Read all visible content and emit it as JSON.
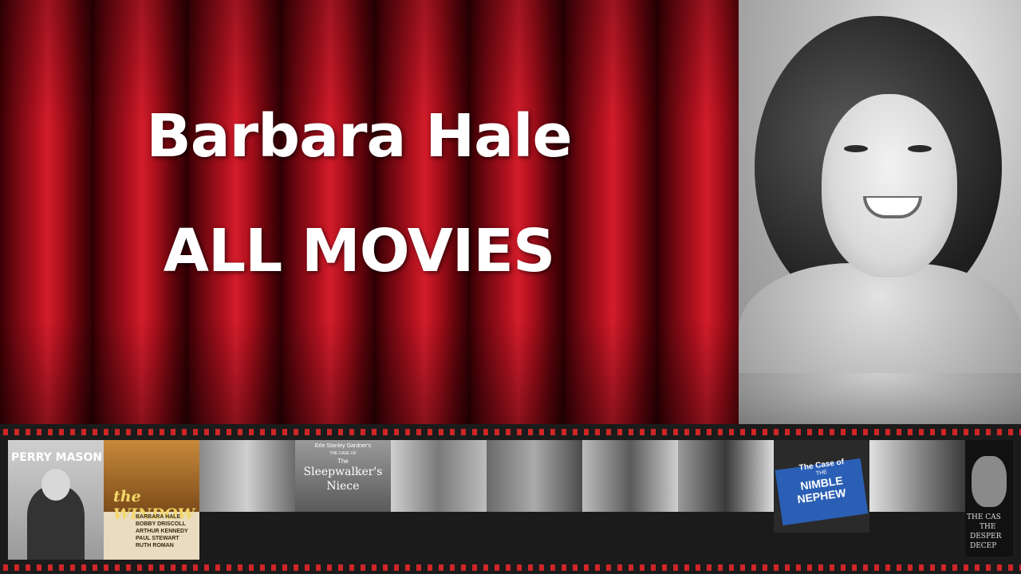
{
  "header": {
    "title_line1": "Barbara Hale",
    "title_line2": "ALL MOVIES"
  },
  "colors": {
    "curtain_red": "#b3121f",
    "film_perforation": "#ce2626",
    "film_background": "#1b1b1b"
  },
  "filmstrip": {
    "thumb1": {
      "label": "PERRY MASON"
    },
    "thumb2": {
      "title": "the WINDOW",
      "credits": [
        "BARBARA HALE",
        "BOBBY DRISCOLL",
        "ARTHUR KENNEDY",
        "PAUL STEWART",
        "RUTH ROMAN"
      ]
    },
    "thumb4": {
      "line1": "Erle Stanley Gardner's",
      "line2": "THE CASE OF",
      "line3": "The",
      "line4": "Sleepwalker's",
      "line5": "Niece"
    },
    "thumb9": {
      "line1": "The Case of",
      "line2": "THE",
      "line3": "NIMBLE",
      "line4": "NEPHEW"
    },
    "thumb11": {
      "line1": "THE CAS",
      "line2": "THE",
      "line3": "DESPER",
      "line4": "DECEP"
    }
  }
}
